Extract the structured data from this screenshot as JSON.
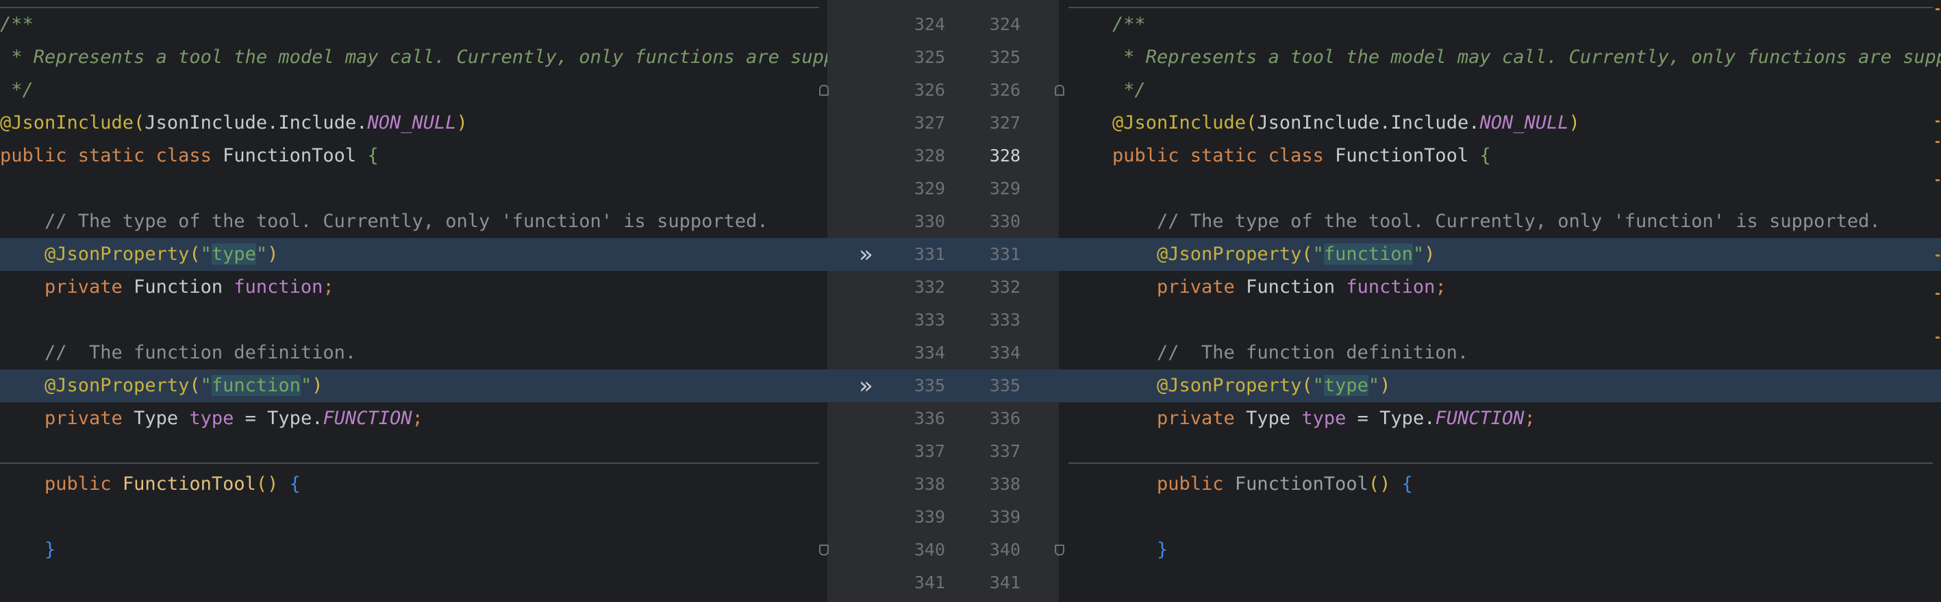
{
  "left_lines": [
    {
      "segments": [
        {
          "text": "/**",
          "cls": "c-comment"
        }
      ]
    },
    {
      "segments": [
        {
          "text": " * Represents a tool the model may call. Currently, only functions are supp",
          "cls": "c-comment"
        }
      ]
    },
    {
      "segments": [
        {
          "text": " */",
          "cls": "c-comment"
        }
      ]
    },
    {
      "segments": [
        {
          "text": "@JsonInclude",
          "cls": "c-ann"
        },
        {
          "text": "(",
          "cls": "c-paren"
        },
        {
          "text": "JsonInclude",
          "cls": "c-plain"
        },
        {
          "text": ".Include.",
          "cls": "c-plain"
        },
        {
          "text": "NON_NULL",
          "cls": "c-const"
        },
        {
          "text": ")",
          "cls": "c-paren"
        }
      ]
    },
    {
      "segments": [
        {
          "text": "public static class ",
          "cls": "c-kw"
        },
        {
          "text": "FunctionTool ",
          "cls": "c-type"
        },
        {
          "text": "{",
          "cls": "c-str"
        }
      ]
    },
    {
      "segments": [
        {
          "text": "",
          "cls": "c-plain"
        }
      ]
    },
    {
      "segments": [
        {
          "text": "    // The type of the tool. Currently, only 'function' is supported.",
          "cls": "c-cmt2"
        }
      ]
    },
    {
      "segments": [
        {
          "text": "    ",
          "cls": "c-plain"
        },
        {
          "text": "@JsonProperty",
          "cls": "c-ann"
        },
        {
          "text": "(",
          "cls": "c-paren"
        },
        {
          "text": "\"",
          "cls": "c-str"
        },
        {
          "text": "type",
          "cls": "c-str str-hl"
        },
        {
          "text": "\"",
          "cls": "c-str"
        },
        {
          "text": ")",
          "cls": "c-paren"
        }
      ],
      "hl": true
    },
    {
      "segments": [
        {
          "text": "    private ",
          "cls": "c-kw"
        },
        {
          "text": "Function ",
          "cls": "c-type"
        },
        {
          "text": "function",
          "cls": "c-field"
        },
        {
          "text": ";",
          "cls": "c-kw"
        }
      ]
    },
    {
      "segments": [
        {
          "text": "",
          "cls": "c-plain"
        }
      ]
    },
    {
      "segments": [
        {
          "text": "    //  The function definition.",
          "cls": "c-cmt2"
        }
      ]
    },
    {
      "segments": [
        {
          "text": "    ",
          "cls": "c-plain"
        },
        {
          "text": "@JsonProperty",
          "cls": "c-ann"
        },
        {
          "text": "(",
          "cls": "c-paren"
        },
        {
          "text": "\"",
          "cls": "c-str"
        },
        {
          "text": "function",
          "cls": "c-str str-hl"
        },
        {
          "text": "\"",
          "cls": "c-str"
        },
        {
          "text": ")",
          "cls": "c-paren"
        }
      ],
      "hl": true
    },
    {
      "segments": [
        {
          "text": "    private ",
          "cls": "c-kw"
        },
        {
          "text": "Type ",
          "cls": "c-type"
        },
        {
          "text": "type",
          "cls": "c-field"
        },
        {
          "text": " = ",
          "cls": "c-plain"
        },
        {
          "text": "Type.",
          "cls": "c-plain"
        },
        {
          "text": "FUNCTION",
          "cls": "c-const"
        },
        {
          "text": ";",
          "cls": "c-kw"
        }
      ]
    },
    {
      "segments": [
        {
          "text": "",
          "cls": "c-plain"
        }
      ]
    },
    {
      "segments": [
        {
          "text": "    public ",
          "cls": "c-kw"
        },
        {
          "text": "FunctionTool",
          "cls": "c-method"
        },
        {
          "text": "() ",
          "cls": "c-paren"
        },
        {
          "text": "{",
          "cls": "c-brace"
        }
      ]
    },
    {
      "segments": [
        {
          "text": "",
          "cls": "c-plain"
        }
      ]
    },
    {
      "segments": [
        {
          "text": "    ",
          "cls": "c-plain"
        },
        {
          "text": "}",
          "cls": "c-brace"
        }
      ]
    },
    {
      "segments": [
        {
          "text": "",
          "cls": "c-plain"
        }
      ]
    }
  ],
  "right_lines": [
    {
      "segments": [
        {
          "text": "/**",
          "cls": "c-comment"
        }
      ]
    },
    {
      "segments": [
        {
          "text": " * Represents a tool the model may call. Currently, only functions are suppo",
          "cls": "c-comment"
        }
      ]
    },
    {
      "segments": [
        {
          "text": " */",
          "cls": "c-comment"
        }
      ]
    },
    {
      "segments": [
        {
          "text": "@JsonInclude",
          "cls": "c-ann"
        },
        {
          "text": "(",
          "cls": "c-paren"
        },
        {
          "text": "JsonInclude",
          "cls": "c-plain"
        },
        {
          "text": ".Include.",
          "cls": "c-plain"
        },
        {
          "text": "NON_NULL",
          "cls": "c-const"
        },
        {
          "text": ")",
          "cls": "c-paren"
        }
      ]
    },
    {
      "segments": [
        {
          "text": "public static class ",
          "cls": "c-kw"
        },
        {
          "text": "FunctionTool ",
          "cls": "c-type"
        },
        {
          "text": "{",
          "cls": "c-str"
        }
      ]
    },
    {
      "segments": [
        {
          "text": "",
          "cls": "c-plain"
        }
      ]
    },
    {
      "segments": [
        {
          "text": "    // The type of the tool. Currently, only 'function' is supported.",
          "cls": "c-cmt2"
        }
      ]
    },
    {
      "segments": [
        {
          "text": "    ",
          "cls": "c-plain"
        },
        {
          "text": "@JsonProperty",
          "cls": "c-ann"
        },
        {
          "text": "(",
          "cls": "c-paren"
        },
        {
          "text": "\"",
          "cls": "c-str"
        },
        {
          "text": "function",
          "cls": "c-str str-hl"
        },
        {
          "text": "\"",
          "cls": "c-str"
        },
        {
          "text": ")",
          "cls": "c-paren"
        }
      ],
      "hl": true
    },
    {
      "segments": [
        {
          "text": "    private ",
          "cls": "c-kw"
        },
        {
          "text": "Function ",
          "cls": "c-type"
        },
        {
          "text": "function",
          "cls": "c-field"
        },
        {
          "text": ";",
          "cls": "c-kw"
        }
      ]
    },
    {
      "segments": [
        {
          "text": "",
          "cls": "c-plain"
        }
      ]
    },
    {
      "segments": [
        {
          "text": "    //  The function definition.",
          "cls": "c-cmt2"
        }
      ]
    },
    {
      "segments": [
        {
          "text": "    ",
          "cls": "c-plain"
        },
        {
          "text": "@JsonProperty",
          "cls": "c-ann"
        },
        {
          "text": "(",
          "cls": "c-paren"
        },
        {
          "text": "\"",
          "cls": "c-str"
        },
        {
          "text": "type",
          "cls": "c-str str-hl"
        },
        {
          "text": "\"",
          "cls": "c-str"
        },
        {
          "text": ")",
          "cls": "c-paren"
        }
      ],
      "hl": true
    },
    {
      "segments": [
        {
          "text": "    private ",
          "cls": "c-kw"
        },
        {
          "text": "Type ",
          "cls": "c-type"
        },
        {
          "text": "type",
          "cls": "c-field"
        },
        {
          "text": " = ",
          "cls": "c-plain"
        },
        {
          "text": "Type.",
          "cls": "c-plain"
        },
        {
          "text": "FUNCTION",
          "cls": "c-const"
        },
        {
          "text": ";",
          "cls": "c-kw"
        }
      ]
    },
    {
      "segments": [
        {
          "text": "",
          "cls": "c-plain"
        }
      ]
    },
    {
      "segments": [
        {
          "text": "    public ",
          "cls": "c-kw"
        },
        {
          "text": "FunctionTool",
          "cls": "c-method-dim"
        },
        {
          "text": "() ",
          "cls": "c-paren"
        },
        {
          "text": "{",
          "cls": "c-brace"
        }
      ]
    },
    {
      "segments": [
        {
          "text": "",
          "cls": "c-plain"
        }
      ]
    },
    {
      "segments": [
        {
          "text": "    ",
          "cls": "c-plain"
        },
        {
          "text": "}",
          "cls": "c-brace"
        }
      ]
    },
    {
      "segments": [
        {
          "text": "",
          "cls": "c-plain"
        }
      ]
    }
  ],
  "line_numbers": [
    "324",
    "325",
    "326",
    "327",
    "328",
    "329",
    "330",
    "331",
    "332",
    "333",
    "334",
    "335",
    "336",
    "337",
    "338",
    "339",
    "340",
    "341"
  ],
  "current_line": "328",
  "changed_lines": [
    "331",
    "335"
  ],
  "icons": {
    "apply": "double-chevron-right-icon",
    "fold": "fold-marker-icon"
  },
  "colors": {
    "highlight_row": "#2b3b4f",
    "accent_marker": "#c48a3c"
  }
}
